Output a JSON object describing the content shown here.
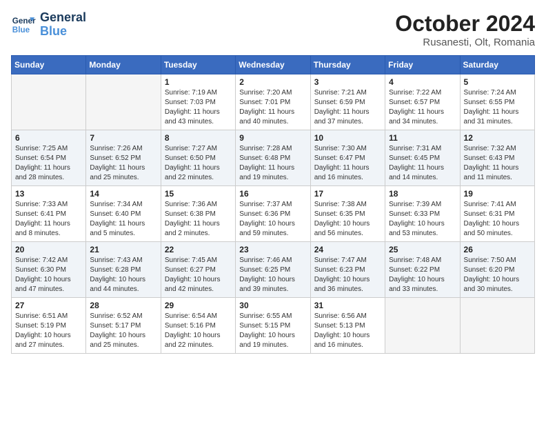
{
  "header": {
    "logo_line1": "General",
    "logo_line2": "Blue",
    "month": "October 2024",
    "location": "Rusanesti, Olt, Romania"
  },
  "days_of_week": [
    "Sunday",
    "Monday",
    "Tuesday",
    "Wednesday",
    "Thursday",
    "Friday",
    "Saturday"
  ],
  "weeks": [
    [
      {
        "day": "",
        "text": ""
      },
      {
        "day": "",
        "text": ""
      },
      {
        "day": "1",
        "text": "Sunrise: 7:19 AM\nSunset: 7:03 PM\nDaylight: 11 hours\nand 43 minutes."
      },
      {
        "day": "2",
        "text": "Sunrise: 7:20 AM\nSunset: 7:01 PM\nDaylight: 11 hours\nand 40 minutes."
      },
      {
        "day": "3",
        "text": "Sunrise: 7:21 AM\nSunset: 6:59 PM\nDaylight: 11 hours\nand 37 minutes."
      },
      {
        "day": "4",
        "text": "Sunrise: 7:22 AM\nSunset: 6:57 PM\nDaylight: 11 hours\nand 34 minutes."
      },
      {
        "day": "5",
        "text": "Sunrise: 7:24 AM\nSunset: 6:55 PM\nDaylight: 11 hours\nand 31 minutes."
      }
    ],
    [
      {
        "day": "6",
        "text": "Sunrise: 7:25 AM\nSunset: 6:54 PM\nDaylight: 11 hours\nand 28 minutes."
      },
      {
        "day": "7",
        "text": "Sunrise: 7:26 AM\nSunset: 6:52 PM\nDaylight: 11 hours\nand 25 minutes."
      },
      {
        "day": "8",
        "text": "Sunrise: 7:27 AM\nSunset: 6:50 PM\nDaylight: 11 hours\nand 22 minutes."
      },
      {
        "day": "9",
        "text": "Sunrise: 7:28 AM\nSunset: 6:48 PM\nDaylight: 11 hours\nand 19 minutes."
      },
      {
        "day": "10",
        "text": "Sunrise: 7:30 AM\nSunset: 6:47 PM\nDaylight: 11 hours\nand 16 minutes."
      },
      {
        "day": "11",
        "text": "Sunrise: 7:31 AM\nSunset: 6:45 PM\nDaylight: 11 hours\nand 14 minutes."
      },
      {
        "day": "12",
        "text": "Sunrise: 7:32 AM\nSunset: 6:43 PM\nDaylight: 11 hours\nand 11 minutes."
      }
    ],
    [
      {
        "day": "13",
        "text": "Sunrise: 7:33 AM\nSunset: 6:41 PM\nDaylight: 11 hours\nand 8 minutes."
      },
      {
        "day": "14",
        "text": "Sunrise: 7:34 AM\nSunset: 6:40 PM\nDaylight: 11 hours\nand 5 minutes."
      },
      {
        "day": "15",
        "text": "Sunrise: 7:36 AM\nSunset: 6:38 PM\nDaylight: 11 hours\nand 2 minutes."
      },
      {
        "day": "16",
        "text": "Sunrise: 7:37 AM\nSunset: 6:36 PM\nDaylight: 10 hours\nand 59 minutes."
      },
      {
        "day": "17",
        "text": "Sunrise: 7:38 AM\nSunset: 6:35 PM\nDaylight: 10 hours\nand 56 minutes."
      },
      {
        "day": "18",
        "text": "Sunrise: 7:39 AM\nSunset: 6:33 PM\nDaylight: 10 hours\nand 53 minutes."
      },
      {
        "day": "19",
        "text": "Sunrise: 7:41 AM\nSunset: 6:31 PM\nDaylight: 10 hours\nand 50 minutes."
      }
    ],
    [
      {
        "day": "20",
        "text": "Sunrise: 7:42 AM\nSunset: 6:30 PM\nDaylight: 10 hours\nand 47 minutes."
      },
      {
        "day": "21",
        "text": "Sunrise: 7:43 AM\nSunset: 6:28 PM\nDaylight: 10 hours\nand 44 minutes."
      },
      {
        "day": "22",
        "text": "Sunrise: 7:45 AM\nSunset: 6:27 PM\nDaylight: 10 hours\nand 42 minutes."
      },
      {
        "day": "23",
        "text": "Sunrise: 7:46 AM\nSunset: 6:25 PM\nDaylight: 10 hours\nand 39 minutes."
      },
      {
        "day": "24",
        "text": "Sunrise: 7:47 AM\nSunset: 6:23 PM\nDaylight: 10 hours\nand 36 minutes."
      },
      {
        "day": "25",
        "text": "Sunrise: 7:48 AM\nSunset: 6:22 PM\nDaylight: 10 hours\nand 33 minutes."
      },
      {
        "day": "26",
        "text": "Sunrise: 7:50 AM\nSunset: 6:20 PM\nDaylight: 10 hours\nand 30 minutes."
      }
    ],
    [
      {
        "day": "27",
        "text": "Sunrise: 6:51 AM\nSunset: 5:19 PM\nDaylight: 10 hours\nand 27 minutes."
      },
      {
        "day": "28",
        "text": "Sunrise: 6:52 AM\nSunset: 5:17 PM\nDaylight: 10 hours\nand 25 minutes."
      },
      {
        "day": "29",
        "text": "Sunrise: 6:54 AM\nSunset: 5:16 PM\nDaylight: 10 hours\nand 22 minutes."
      },
      {
        "day": "30",
        "text": "Sunrise: 6:55 AM\nSunset: 5:15 PM\nDaylight: 10 hours\nand 19 minutes."
      },
      {
        "day": "31",
        "text": "Sunrise: 6:56 AM\nSunset: 5:13 PM\nDaylight: 10 hours\nand 16 minutes."
      },
      {
        "day": "",
        "text": ""
      },
      {
        "day": "",
        "text": ""
      }
    ]
  ]
}
